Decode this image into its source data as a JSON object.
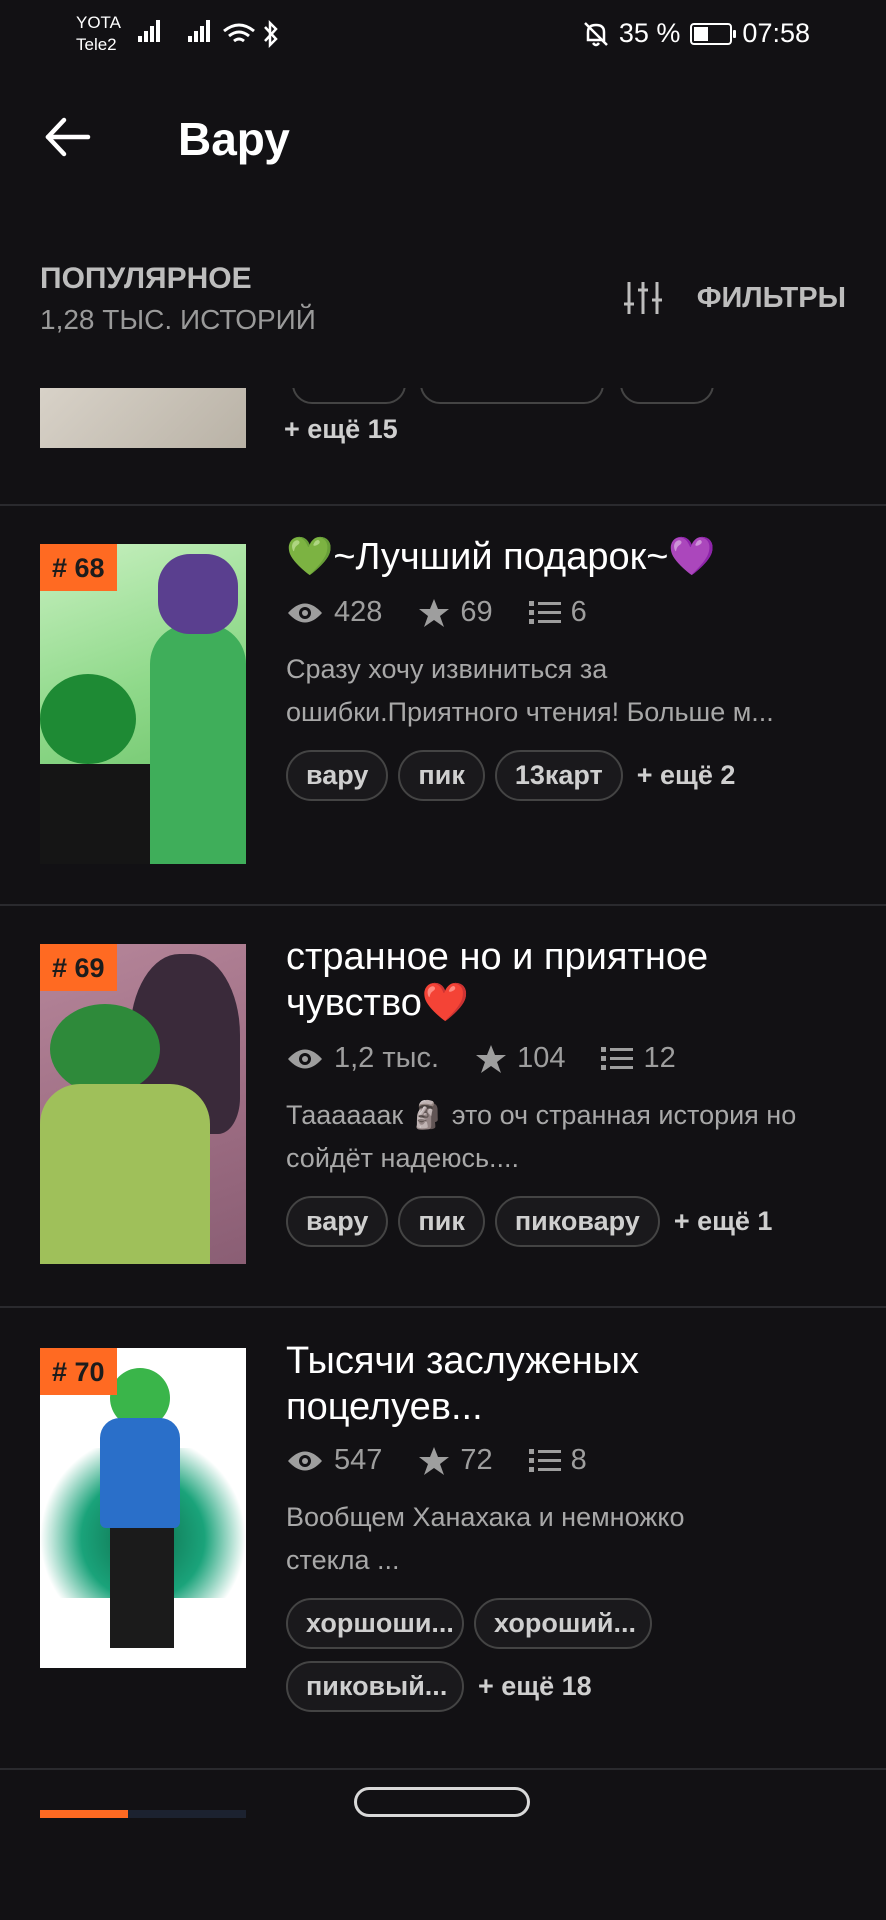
{
  "status_bar": {
    "carrier_top": "YOTA",
    "carrier_bottom": "Tele2",
    "battery_percent": "35 %",
    "battery_level": 0.35,
    "time": "07:58"
  },
  "app_bar": {
    "title": "Вару"
  },
  "section": {
    "title": "ПОПУЛЯРНОЕ",
    "subtitle": "1,28 ТЫС. ИСТОРИЙ",
    "filters_label": "ФИЛЬТРЫ"
  },
  "partial_item": {
    "more": "+ ещё 15"
  },
  "items": [
    {
      "rank": "# 68",
      "title": "💚~Лучший подарок~💜",
      "views": "428",
      "stars": "69",
      "parts": "6",
      "description": "Сразу хочу извиниться за ошибки.Приятного чтения! Больше м...",
      "tags": [
        "вару",
        "пик",
        "13карт"
      ],
      "more": "+ ещё 2"
    },
    {
      "rank": "# 69",
      "title": "странное но и приятное чувство❤️",
      "views": "1,2 тыс.",
      "stars": "104",
      "parts": "12",
      "description": "Таааааак 🗿 это оч странная история но сойдёт надеюсь....",
      "tags": [
        "вару",
        "пик",
        "пиковару"
      ],
      "more": "+ ещё 1"
    },
    {
      "rank": "# 70",
      "title": "Тысячи заслуженых поцелуев...",
      "views": "547",
      "stars": "72",
      "parts": "8",
      "description": "Вообщем Ханахака и немножко стекла ...",
      "tags": [
        "хоршоши...",
        "хороший...",
        "пиковый..."
      ],
      "more": "+ ещё 18"
    }
  ]
}
